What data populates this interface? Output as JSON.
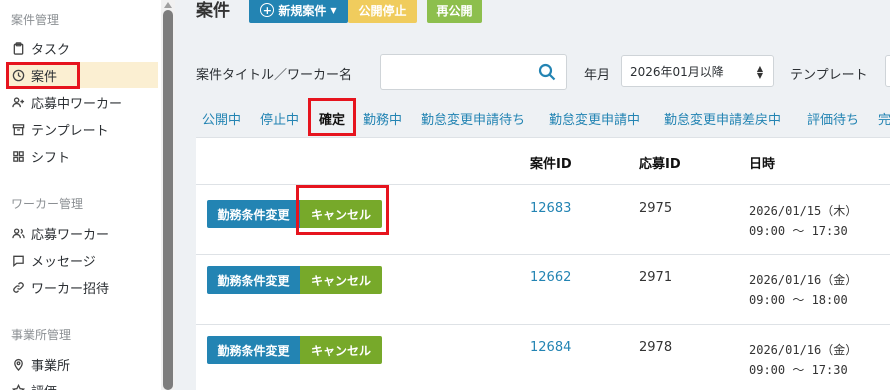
{
  "sidebar": {
    "sections": [
      {
        "title": "案件管理",
        "items": [
          {
            "label": "タスク",
            "icon": "clipboard-icon"
          },
          {
            "label": "案件",
            "icon": "clock-icon",
            "active": true
          },
          {
            "label": "応募中ワーカー",
            "icon": "user-plus-icon"
          },
          {
            "label": "テンプレート",
            "icon": "archive-icon"
          },
          {
            "label": "シフト",
            "icon": "grid-icon"
          }
        ]
      },
      {
        "title": "ワーカー管理",
        "items": [
          {
            "label": "応募ワーカー",
            "icon": "users-icon"
          },
          {
            "label": "メッセージ",
            "icon": "message-icon"
          },
          {
            "label": "ワーカー招待",
            "icon": "link-icon"
          }
        ]
      },
      {
        "title": "事業所管理",
        "items": [
          {
            "label": "事業所",
            "icon": "map-pin-icon"
          },
          {
            "label": "評価",
            "icon": "star-icon"
          }
        ]
      }
    ]
  },
  "header": {
    "title": "案件",
    "new_label": "新規案件",
    "stop_label": "公開停止",
    "republish_label": "再公開"
  },
  "filters": {
    "title_label": "案件タイトル／ワーカー名",
    "search_value": "",
    "month_label": "年月",
    "month_value": "2026年01月以降",
    "template_label": "テンプレート"
  },
  "tabs": [
    "公開中",
    "停止中",
    "確定",
    "勤務中",
    "勤怠変更申請待ち",
    "勤怠変更申請中",
    "勤怠変更申請差戻中",
    "評価待ち",
    "完"
  ],
  "active_tab": "確定",
  "table": {
    "headers": [
      "案件ID",
      "応募ID",
      "日時"
    ],
    "rows": [
      {
        "change": "勤務条件変更",
        "cancel": "キャンセル",
        "job_id": "12683",
        "app_id": "2975",
        "date": "2026/01/15（木）",
        "time": "09:00 ～ 17:30"
      },
      {
        "change": "勤務条件変更",
        "cancel": "キャンセル",
        "job_id": "12662",
        "app_id": "2971",
        "date": "2026/01/16（金）",
        "time": "09:00 ～ 18:00"
      },
      {
        "change": "勤務条件変更",
        "cancel": "キャンセル",
        "job_id": "12684",
        "app_id": "2978",
        "date": "2026/01/16（金）",
        "time": "09:00 ～ 17:30"
      }
    ]
  },
  "colors": {
    "primary": "#2384b3",
    "cancel": "#77a92a",
    "stop": "#f0cc5d",
    "republish": "#8dbf4d",
    "highlight": "#e6141e"
  }
}
